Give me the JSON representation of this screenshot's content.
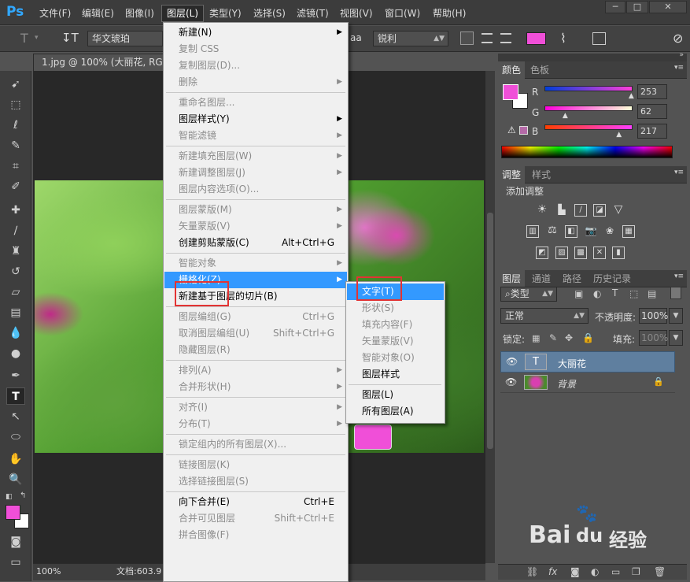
{
  "app": {
    "logo": "Ps"
  },
  "menubar": {
    "items": [
      "文件(F)",
      "编辑(E)",
      "图像(I)",
      "图层(L)",
      "类型(Y)",
      "选择(S)",
      "滤镜(T)",
      "视图(V)",
      "窗口(W)",
      "帮助(H)"
    ],
    "active": "图层(L)",
    "window_buttons": [
      "─",
      "□",
      "✕"
    ]
  },
  "options": {
    "tool_icon": "T",
    "font_family": "华文琥珀",
    "antialias": "锐利",
    "aa_label": "a",
    "text_color": "#f04fd8"
  },
  "document": {
    "tab_title": "1.jpg @ 100% (大丽花, RGB/8)",
    "zoom": "100%",
    "doc_info": "文档:603.9"
  },
  "layer_menu": {
    "items": [
      {
        "label": "新建(N)",
        "enabled": true,
        "submenu": true
      },
      {
        "label": "复制 CSS",
        "enabled": false
      },
      {
        "label": "复制图层(D)...",
        "enabled": false
      },
      {
        "label": "删除",
        "enabled": false,
        "submenu": true
      },
      {
        "sep": true
      },
      {
        "label": "重命名图层...",
        "enabled": false
      },
      {
        "label": "图层样式(Y)",
        "enabled": true,
        "submenu": true
      },
      {
        "label": "智能滤镜",
        "enabled": false,
        "submenu": true
      },
      {
        "sep": true
      },
      {
        "label": "新建填充图层(W)",
        "enabled": false,
        "submenu": true
      },
      {
        "label": "新建调整图层(J)",
        "enabled": false,
        "submenu": true
      },
      {
        "label": "图层内容选项(O)...",
        "enabled": false
      },
      {
        "sep": true
      },
      {
        "label": "图层蒙版(M)",
        "enabled": false,
        "submenu": true
      },
      {
        "label": "矢量蒙版(V)",
        "enabled": false,
        "submenu": true
      },
      {
        "label": "创建剪贴蒙版(C)",
        "enabled": true,
        "shortcut": "Alt+Ctrl+G"
      },
      {
        "sep": true
      },
      {
        "label": "智能对象",
        "enabled": false,
        "submenu": true
      },
      {
        "label": "栅格化(Z)",
        "enabled": true,
        "submenu": true,
        "highlighted": true
      },
      {
        "label": "新建基于图层的切片(B)",
        "enabled": true
      },
      {
        "sep": true
      },
      {
        "label": "图层编组(G)",
        "enabled": false,
        "shortcut": "Ctrl+G"
      },
      {
        "label": "取消图层编组(U)",
        "enabled": false,
        "shortcut": "Shift+Ctrl+G"
      },
      {
        "label": "隐藏图层(R)",
        "enabled": false
      },
      {
        "sep": true
      },
      {
        "label": "排列(A)",
        "enabled": false,
        "submenu": true
      },
      {
        "label": "合并形状(H)",
        "enabled": false,
        "submenu": true
      },
      {
        "sep": true
      },
      {
        "label": "对齐(I)",
        "enabled": false,
        "submenu": true
      },
      {
        "label": "分布(T)",
        "enabled": false,
        "submenu": true
      },
      {
        "sep": true
      },
      {
        "label": "锁定组内的所有图层(X)...",
        "enabled": false
      },
      {
        "sep": true
      },
      {
        "label": "链接图层(K)",
        "enabled": false
      },
      {
        "label": "选择链接图层(S)",
        "enabled": false
      },
      {
        "sep": true
      },
      {
        "label": "向下合并(E)",
        "enabled": true,
        "shortcut": "Ctrl+E"
      },
      {
        "label": "合并可见图层",
        "enabled": false,
        "shortcut": "Shift+Ctrl+E"
      },
      {
        "label": "拼合图像(F)",
        "enabled": false
      }
    ]
  },
  "rasterize_submenu": {
    "items": [
      {
        "label": "文字(T)",
        "enabled": true,
        "highlighted": true
      },
      {
        "label": "形状(S)",
        "enabled": false
      },
      {
        "label": "填充内容(F)",
        "enabled": false
      },
      {
        "label": "矢量蒙版(V)",
        "enabled": false
      },
      {
        "label": "智能对象(O)",
        "enabled": false
      },
      {
        "label": "图层样式",
        "enabled": true
      },
      {
        "sep": true
      },
      {
        "label": "图层(L)",
        "enabled": true
      },
      {
        "label": "所有图层(A)",
        "enabled": true
      }
    ]
  },
  "color_panel": {
    "tabs": [
      "颜色",
      "色板"
    ],
    "channels": [
      {
        "name": "R",
        "value": "253",
        "level": 0.99
      },
      {
        "name": "G",
        "value": "62",
        "level": 0.24
      },
      {
        "name": "B",
        "value": "217",
        "level": 0.85
      }
    ],
    "foreground": "#f04fd8",
    "background": "#ffffff",
    "warning_icon": "⚠"
  },
  "adjustments_panel": {
    "tabs": [
      "调整",
      "样式"
    ],
    "title": "添加调整"
  },
  "layers_panel": {
    "tabs": [
      "图层",
      "通道",
      "路径",
      "历史记录"
    ],
    "filter": "类型",
    "blend_mode": "正常",
    "opacity_label": "不透明度:",
    "opacity": "100%",
    "lock_label": "锁定:",
    "fill_label": "填充:",
    "fill": "100%",
    "layers": [
      {
        "name": "大丽花",
        "type": "text",
        "thumb": "T",
        "selected": true
      },
      {
        "name": "背景",
        "type": "image",
        "locked": true
      }
    ]
  },
  "watermark": {
    "text": "Bai",
    "text2": "经验",
    "paw": "du"
  }
}
